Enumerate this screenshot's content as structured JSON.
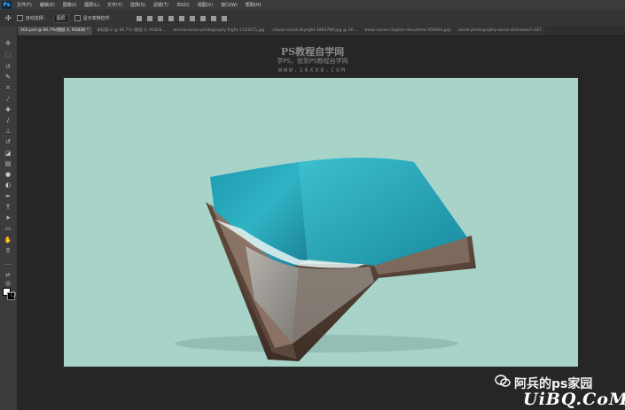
{
  "app": {
    "logo": "Ps"
  },
  "menu": [
    "文件(F)",
    "编辑(E)",
    "图像(I)",
    "图层(L)",
    "文字(Y)",
    "选择(S)",
    "滤镜(T)",
    "3D(D)",
    "视图(V)",
    "窗口(W)",
    "帮助(H)"
  ],
  "options": {
    "auto_select_label": "自动选择：",
    "auto_select_value": "图层",
    "show_transform_label": "显示变换控件"
  },
  "tabs": [
    {
      "label": "502.psd @ 66.7%(图层 3, RGB/8) *",
      "active": true
    },
    {
      "label": "未标题-2 @ 66.7% (图层 0, RGB/8...",
      "active": false
    },
    {
      "label": "animal-avian-photography-flight-1723475.jpg",
      "active": false
    },
    {
      "label": "clouds-covid-daylight-1804766.jpg @ 26...",
      "active": false
    },
    {
      "label": "book-series-chapter-document-459924.jpg",
      "active": false
    },
    {
      "label": "aerial-photography-aerial-shot-beach-187",
      "active": false
    }
  ],
  "watermark": {
    "title": "PS教程自学网",
    "subtitle": "学PS，就到PS教程自学网",
    "url": "WWW.16XX8.COM"
  },
  "footer": {
    "account": "阿兵的ps家园",
    "site": "UiBQ.CoM"
  },
  "colors": {
    "canvas_bg": "#a8d3c9",
    "foreground_swatch": "#ffffff",
    "background_swatch": "#000000"
  }
}
